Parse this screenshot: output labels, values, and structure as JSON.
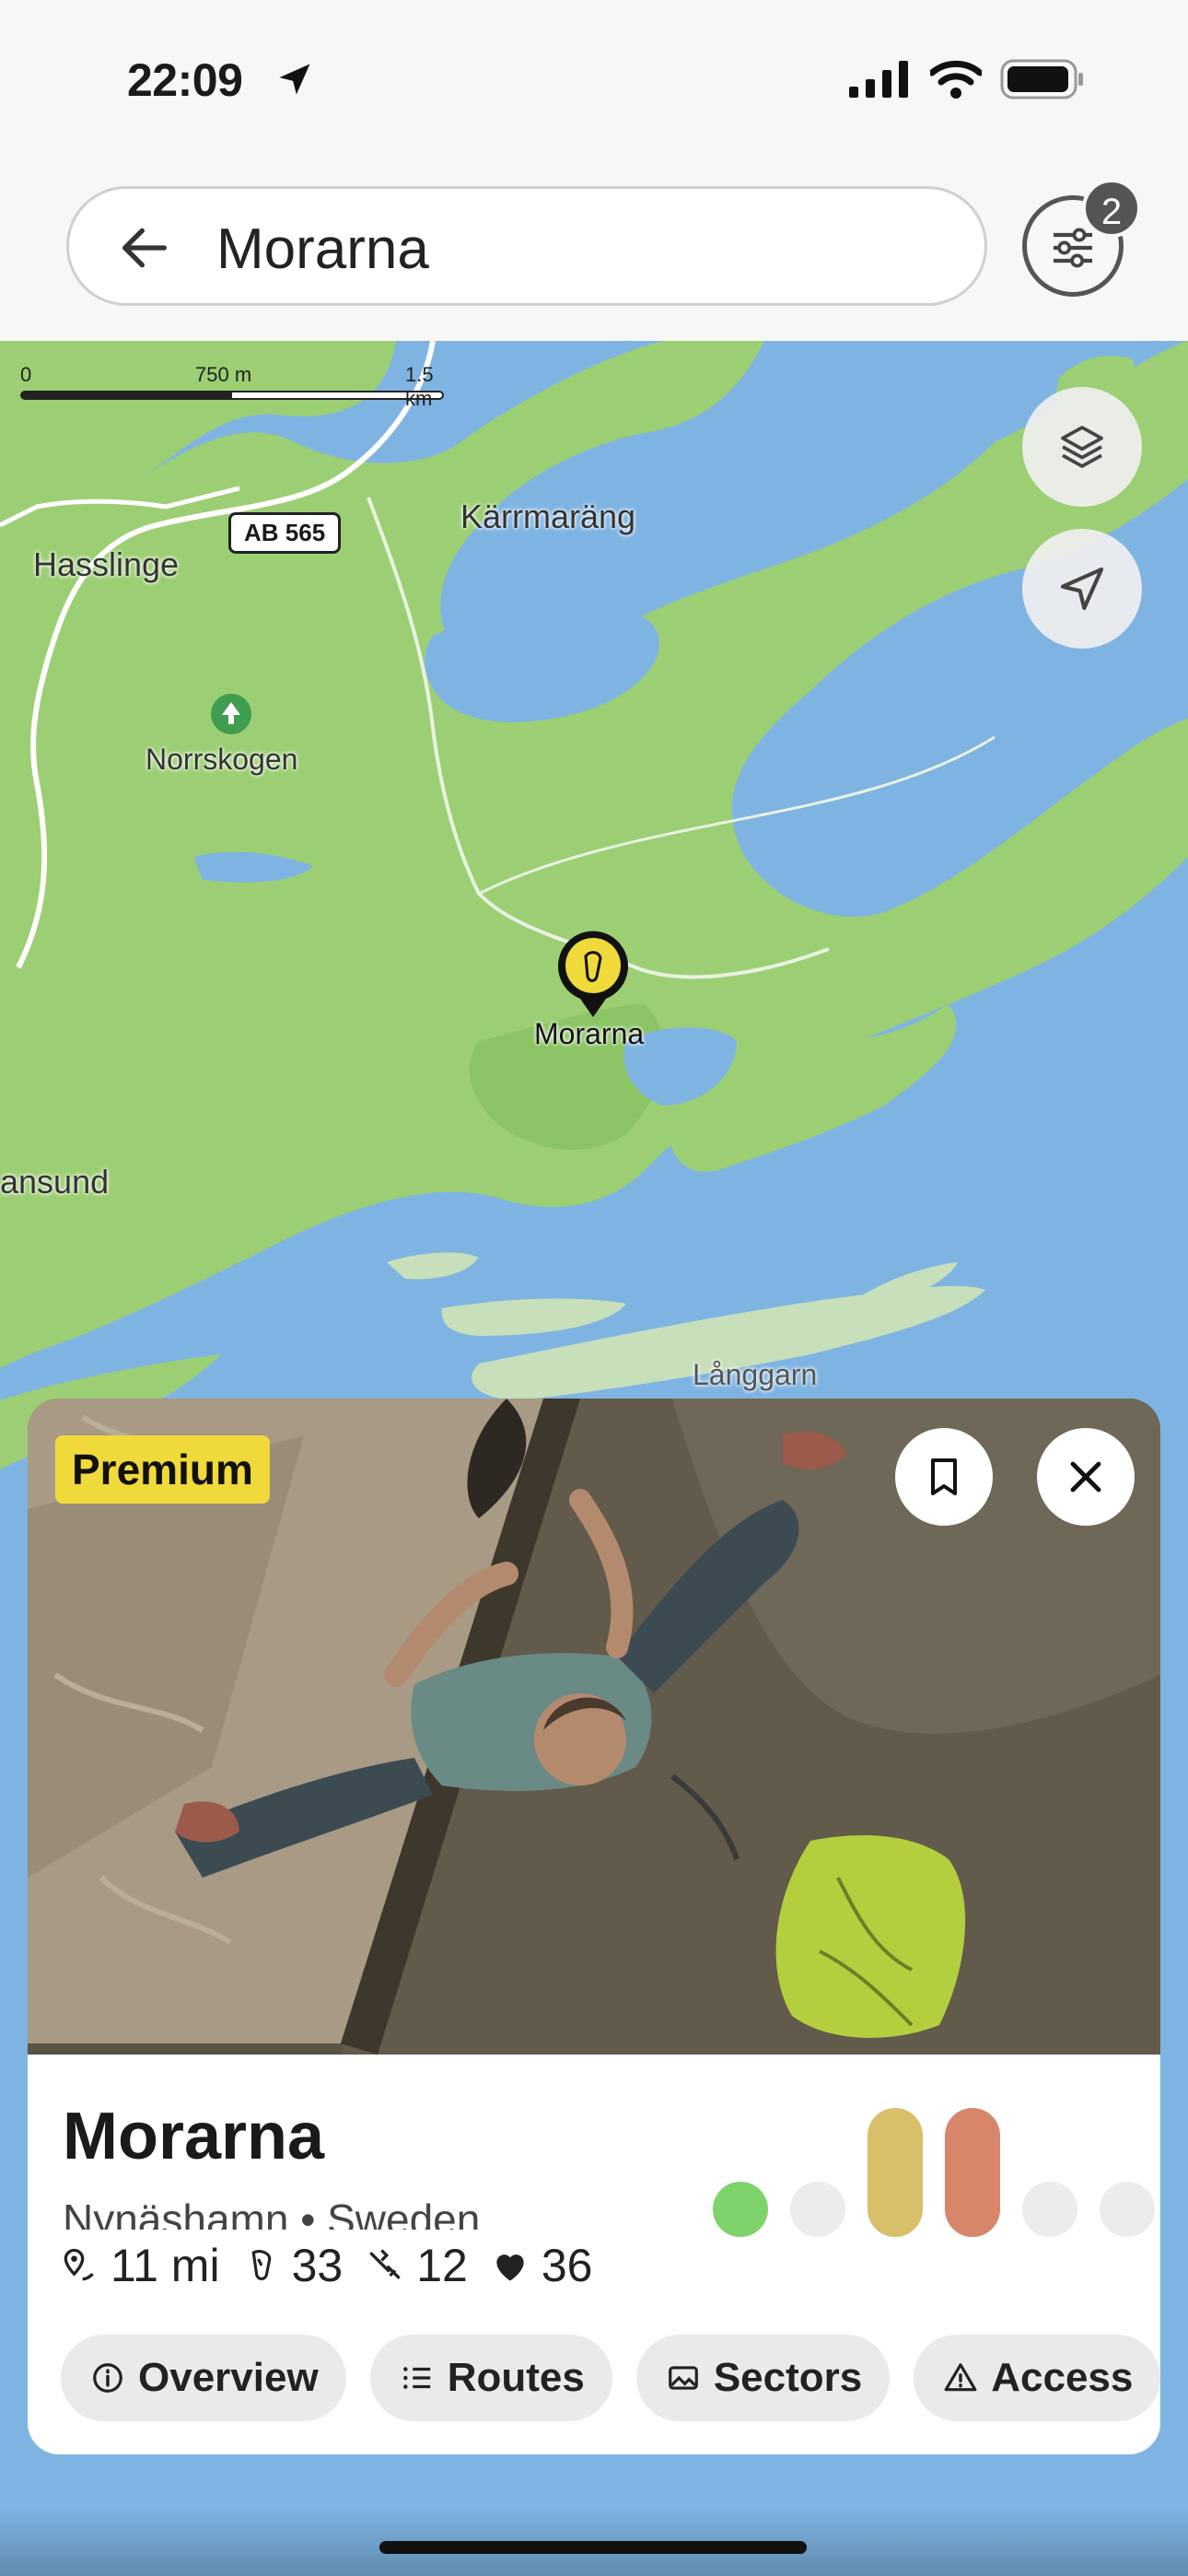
{
  "status_bar": {
    "time": "22:09"
  },
  "search": {
    "query": "Morarna",
    "filter_count": "2"
  },
  "map": {
    "scale_labels": [
      "0",
      "750 m",
      "1.5 km"
    ],
    "road_badge": "AB 565",
    "places": {
      "hasslinge": "Hasslinge",
      "karrmarang": "Kärrmaräng",
      "norrskogen": "Norrskogen",
      "morarna": "Morarna",
      "ansund": "ansund",
      "langgarn": "Långgarn"
    }
  },
  "card": {
    "badge": "Premium",
    "title": "Morarna",
    "subtitle": "Nynäshamn • Sweden",
    "stats": {
      "distance": "11 mi",
      "routes": "33",
      "sectors": "12",
      "likes": "36"
    },
    "grade_distribution": [
      {
        "color": "#7ed36b",
        "level": 0.25
      },
      {
        "color": "#ececec",
        "level": 0.2
      },
      {
        "color": "#d8bf6a",
        "level": 1.0
      },
      {
        "color": "#d8866a",
        "level": 1.0
      },
      {
        "color": "#ececec",
        "level": 0.2
      },
      {
        "color": "#ececec",
        "level": 0.2
      }
    ],
    "tabs": [
      "Overview",
      "Routes",
      "Sectors",
      "Access"
    ]
  }
}
